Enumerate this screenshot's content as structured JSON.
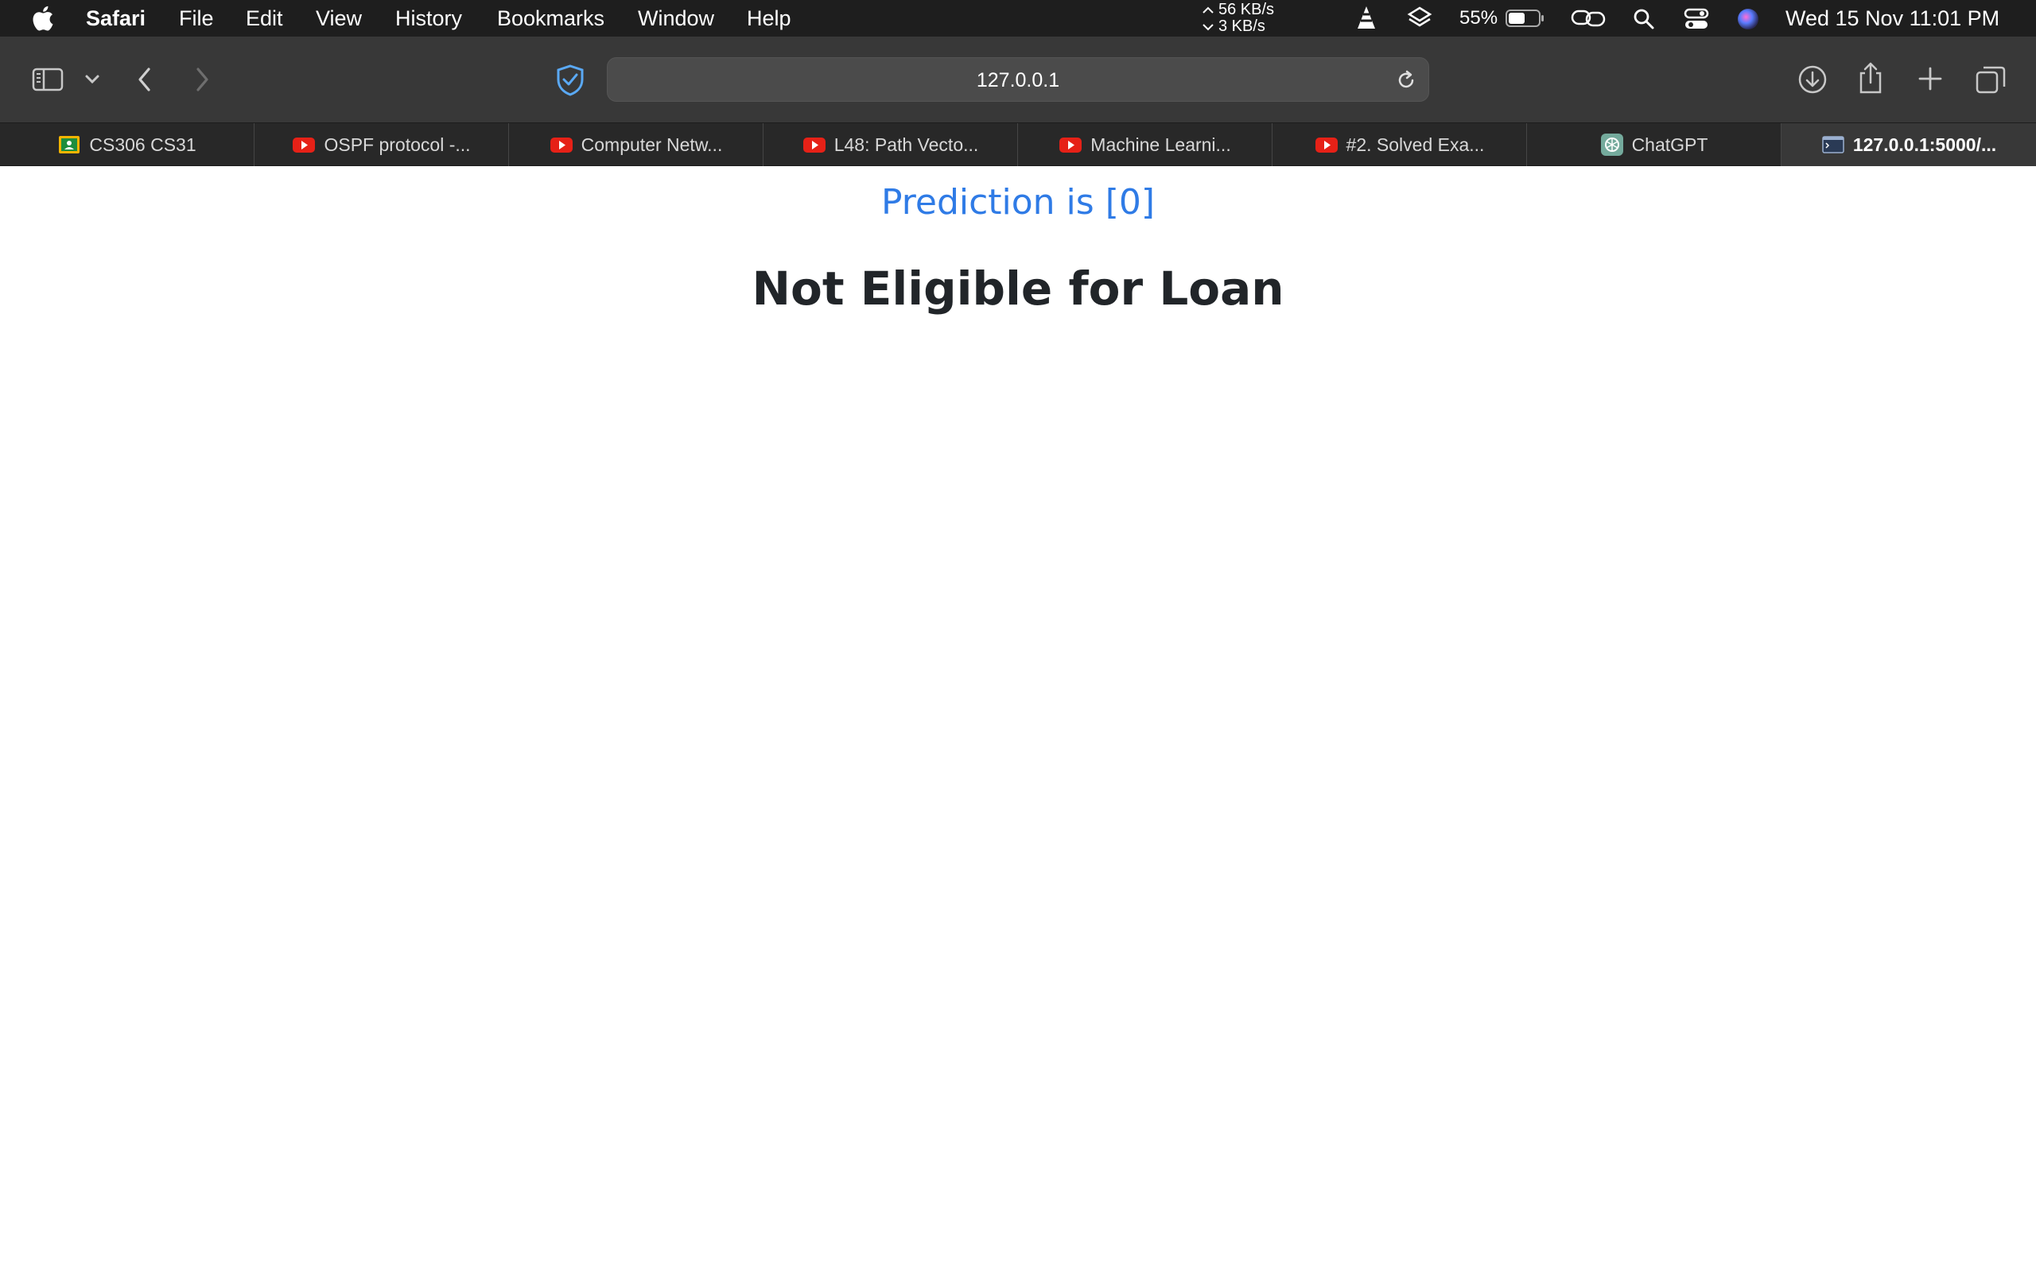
{
  "menubar": {
    "app_name": "Safari",
    "items": [
      "File",
      "Edit",
      "View",
      "History",
      "Bookmarks",
      "Window",
      "Help"
    ],
    "net_up": "56 KB/s",
    "net_down": "3 KB/s",
    "battery": "55%",
    "battery_level": 0.55,
    "datetime": "Wed 15 Nov  11:01 PM"
  },
  "toolbar": {
    "url": "127.0.0.1"
  },
  "tabs": [
    {
      "label": "CS306 CS31",
      "icon": "classroom-icon"
    },
    {
      "label": "OSPF protocol -...",
      "icon": "youtube-icon"
    },
    {
      "label": "Computer Netw...",
      "icon": "youtube-icon"
    },
    {
      "label": "L48: Path Vecto...",
      "icon": "youtube-icon"
    },
    {
      "label": "Machine Learni...",
      "icon": "youtube-icon"
    },
    {
      "label": "#2. Solved Exa...",
      "icon": "youtube-icon"
    },
    {
      "label": "ChatGPT",
      "icon": "chatgpt-icon"
    },
    {
      "label": "127.0.0.1:5000/...",
      "icon": "terminal-page-icon",
      "active": true
    }
  ],
  "page": {
    "prediction": "Prediction is [0]",
    "result": "Not Eligible for Loan"
  },
  "colors": {
    "prediction": "#2f7be6",
    "result": "#212529",
    "youtube": "#e62117"
  }
}
